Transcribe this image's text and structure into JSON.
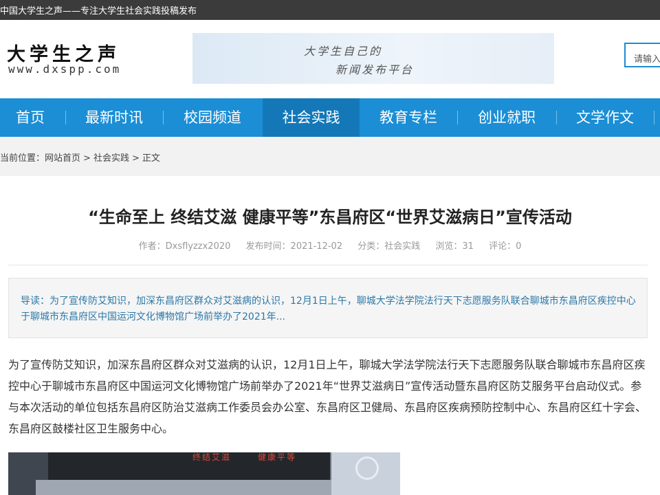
{
  "topbar": {
    "text": "中国大学生之声——专注大学生社会实践投稿发布"
  },
  "header": {
    "logo_main": "大学生之声",
    "logo_sub": "www.dxspp.com",
    "banner_line1": "大学生自己的",
    "banner_line2": "新闻发布平台",
    "search_placeholder": "请输入"
  },
  "nav": {
    "items": [
      {
        "label": "首页"
      },
      {
        "label": "最新时讯"
      },
      {
        "label": "校园频道"
      },
      {
        "label": "社会实践"
      },
      {
        "label": "教育专栏"
      },
      {
        "label": "创业就职"
      },
      {
        "label": "文学作文"
      }
    ],
    "active": "社会实践"
  },
  "breadcrumb": {
    "prefix": "当前位置：",
    "home": "网站首页",
    "category": "社会实践",
    "current": "正文",
    "separator": ">"
  },
  "article": {
    "title": "“生命至上 终结艾滋 健康平等”东昌府区“世界艾滋病日”宣传活动",
    "meta": {
      "author": "作者：Dxsflyzzx2020",
      "date": "发布时间：2021-12-02",
      "category": "分类：社会实践",
      "views": "浏览：31",
      "comments": "评论：0"
    },
    "summary": "导读：为了宣传防艾知识，加深东昌府区群众对艾滋病的认识，12月1日上午，聊城大学法学院法行天下志愿服务队联合聊城市东昌府区疾控中心于聊城市东昌府区中国运河文化博物馆广场前举办了2021年...",
    "body": "为了宣传防艾知识，加深东昌府区群众对艾滋病的认识，12月1日上午，聊城大学法学院法行天下志愿服务队联合聊城市东昌府区疾控中心于聊城市东昌府区中国运河文化博物馆广场前举办了2021年“世界艾滋病日”宣传活动暨东昌府区防艾服务平台启动仪式。参与本次活动的单位包括东昌府区防治艾滋病工作委员会办公室、东昌府区卫健局、东昌府区疾病预防控制中心、东昌府区红十字会、东昌府区鼓楼社区卫生服务中心。",
    "photo_text": [
      "终结艾滋",
      "健康平等"
    ]
  }
}
